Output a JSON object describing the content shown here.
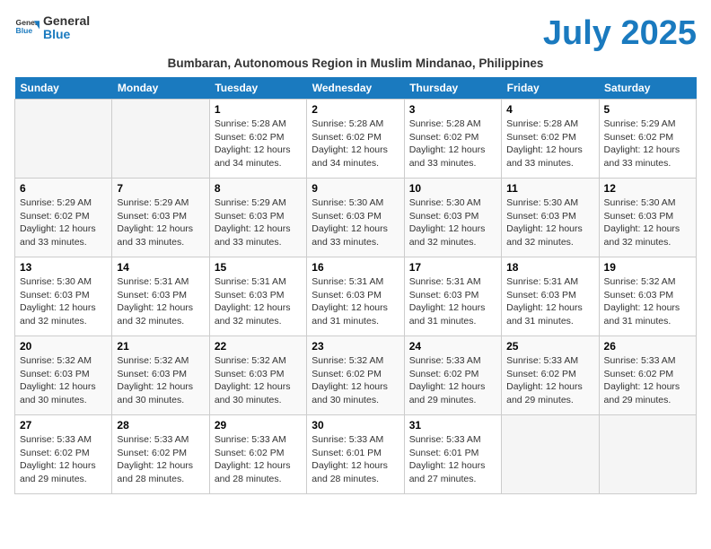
{
  "header": {
    "logo_line1": "General",
    "logo_line2": "Blue",
    "month_title": "July 2025",
    "subtitle": "Bumbaran, Autonomous Region in Muslim Mindanao, Philippines"
  },
  "days_of_week": [
    "Sunday",
    "Monday",
    "Tuesday",
    "Wednesday",
    "Thursday",
    "Friday",
    "Saturday"
  ],
  "weeks": [
    [
      {
        "num": "",
        "info": ""
      },
      {
        "num": "",
        "info": ""
      },
      {
        "num": "1",
        "info": "Sunrise: 5:28 AM\nSunset: 6:02 PM\nDaylight: 12 hours and 34 minutes."
      },
      {
        "num": "2",
        "info": "Sunrise: 5:28 AM\nSunset: 6:02 PM\nDaylight: 12 hours and 34 minutes."
      },
      {
        "num": "3",
        "info": "Sunrise: 5:28 AM\nSunset: 6:02 PM\nDaylight: 12 hours and 33 minutes."
      },
      {
        "num": "4",
        "info": "Sunrise: 5:28 AM\nSunset: 6:02 PM\nDaylight: 12 hours and 33 minutes."
      },
      {
        "num": "5",
        "info": "Sunrise: 5:29 AM\nSunset: 6:02 PM\nDaylight: 12 hours and 33 minutes."
      }
    ],
    [
      {
        "num": "6",
        "info": "Sunrise: 5:29 AM\nSunset: 6:02 PM\nDaylight: 12 hours and 33 minutes."
      },
      {
        "num": "7",
        "info": "Sunrise: 5:29 AM\nSunset: 6:03 PM\nDaylight: 12 hours and 33 minutes."
      },
      {
        "num": "8",
        "info": "Sunrise: 5:29 AM\nSunset: 6:03 PM\nDaylight: 12 hours and 33 minutes."
      },
      {
        "num": "9",
        "info": "Sunrise: 5:30 AM\nSunset: 6:03 PM\nDaylight: 12 hours and 33 minutes."
      },
      {
        "num": "10",
        "info": "Sunrise: 5:30 AM\nSunset: 6:03 PM\nDaylight: 12 hours and 32 minutes."
      },
      {
        "num": "11",
        "info": "Sunrise: 5:30 AM\nSunset: 6:03 PM\nDaylight: 12 hours and 32 minutes."
      },
      {
        "num": "12",
        "info": "Sunrise: 5:30 AM\nSunset: 6:03 PM\nDaylight: 12 hours and 32 minutes."
      }
    ],
    [
      {
        "num": "13",
        "info": "Sunrise: 5:30 AM\nSunset: 6:03 PM\nDaylight: 12 hours and 32 minutes."
      },
      {
        "num": "14",
        "info": "Sunrise: 5:31 AM\nSunset: 6:03 PM\nDaylight: 12 hours and 32 minutes."
      },
      {
        "num": "15",
        "info": "Sunrise: 5:31 AM\nSunset: 6:03 PM\nDaylight: 12 hours and 32 minutes."
      },
      {
        "num": "16",
        "info": "Sunrise: 5:31 AM\nSunset: 6:03 PM\nDaylight: 12 hours and 31 minutes."
      },
      {
        "num": "17",
        "info": "Sunrise: 5:31 AM\nSunset: 6:03 PM\nDaylight: 12 hours and 31 minutes."
      },
      {
        "num": "18",
        "info": "Sunrise: 5:31 AM\nSunset: 6:03 PM\nDaylight: 12 hours and 31 minutes."
      },
      {
        "num": "19",
        "info": "Sunrise: 5:32 AM\nSunset: 6:03 PM\nDaylight: 12 hours and 31 minutes."
      }
    ],
    [
      {
        "num": "20",
        "info": "Sunrise: 5:32 AM\nSunset: 6:03 PM\nDaylight: 12 hours and 30 minutes."
      },
      {
        "num": "21",
        "info": "Sunrise: 5:32 AM\nSunset: 6:03 PM\nDaylight: 12 hours and 30 minutes."
      },
      {
        "num": "22",
        "info": "Sunrise: 5:32 AM\nSunset: 6:03 PM\nDaylight: 12 hours and 30 minutes."
      },
      {
        "num": "23",
        "info": "Sunrise: 5:32 AM\nSunset: 6:02 PM\nDaylight: 12 hours and 30 minutes."
      },
      {
        "num": "24",
        "info": "Sunrise: 5:33 AM\nSunset: 6:02 PM\nDaylight: 12 hours and 29 minutes."
      },
      {
        "num": "25",
        "info": "Sunrise: 5:33 AM\nSunset: 6:02 PM\nDaylight: 12 hours and 29 minutes."
      },
      {
        "num": "26",
        "info": "Sunrise: 5:33 AM\nSunset: 6:02 PM\nDaylight: 12 hours and 29 minutes."
      }
    ],
    [
      {
        "num": "27",
        "info": "Sunrise: 5:33 AM\nSunset: 6:02 PM\nDaylight: 12 hours and 29 minutes."
      },
      {
        "num": "28",
        "info": "Sunrise: 5:33 AM\nSunset: 6:02 PM\nDaylight: 12 hours and 28 minutes."
      },
      {
        "num": "29",
        "info": "Sunrise: 5:33 AM\nSunset: 6:02 PM\nDaylight: 12 hours and 28 minutes."
      },
      {
        "num": "30",
        "info": "Sunrise: 5:33 AM\nSunset: 6:01 PM\nDaylight: 12 hours and 28 minutes."
      },
      {
        "num": "31",
        "info": "Sunrise: 5:33 AM\nSunset: 6:01 PM\nDaylight: 12 hours and 27 minutes."
      },
      {
        "num": "",
        "info": ""
      },
      {
        "num": "",
        "info": ""
      }
    ]
  ]
}
